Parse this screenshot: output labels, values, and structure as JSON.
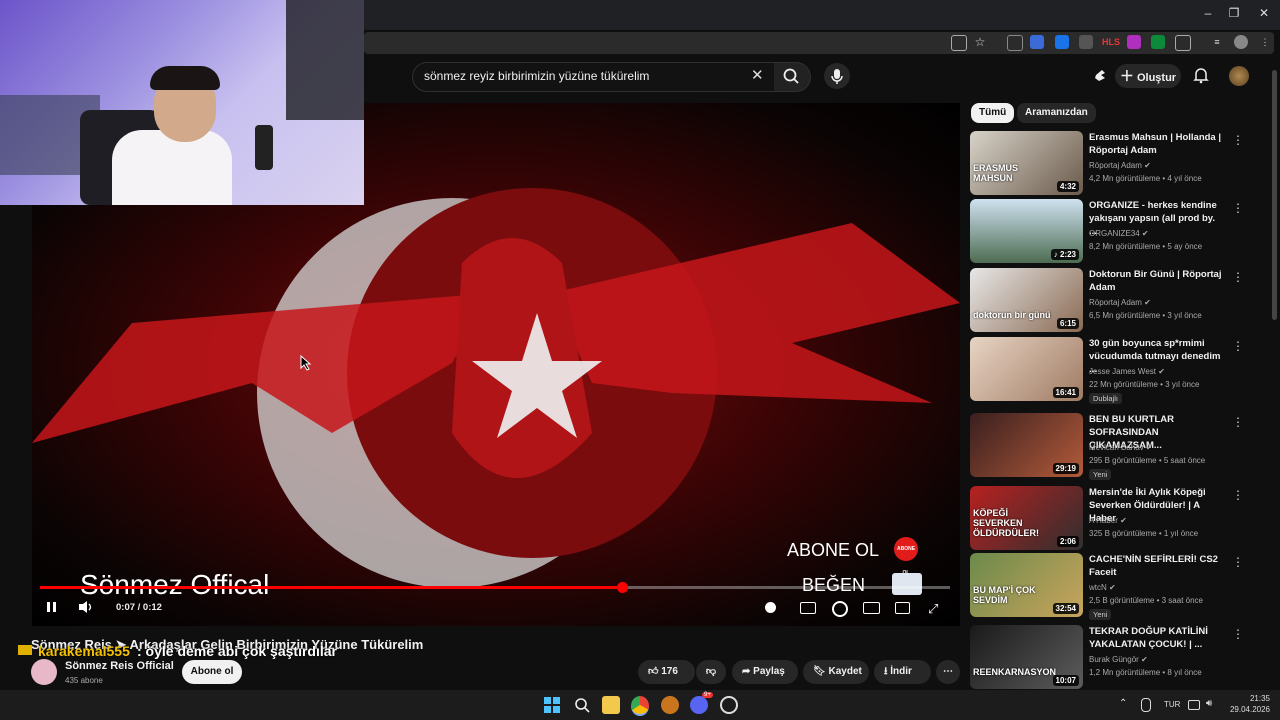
{
  "browser": {
    "window_controls": [
      "–",
      "❐",
      "✕"
    ]
  },
  "header": {
    "search_query": "sönmez reyiz birbirimizin yüzüne tükürelim",
    "create_label": "Oluştur"
  },
  "chips": [
    "Tümü",
    "Aramanızdan"
  ],
  "player": {
    "overlay_subscribe": "ABONE OL",
    "overlay_subscribe_icon": "ABONE OL",
    "overlay_like": "BEĞEN",
    "watermark": "Sönmez Offical",
    "time": "0:07 / 0:12",
    "progress": 0.64
  },
  "video": {
    "title": "Sönmez Reis ➤ Arkadaşlar Gelin Birbirimizin Yüzüne Tükürelim",
    "chat_user": "karakemal555",
    "chat_message": ": öyle deme abi çok şaştırdılar",
    "channel": "Sönmez Reis  Official",
    "subscribers": "435 abone",
    "subscribe_label": "Abone ol",
    "likes": "176",
    "share_label": "Paylaş",
    "save_label": "Kaydet",
    "download_label": "İndir"
  },
  "recommendations": [
    {
      "title": "Erasmus Mahsun | Hollanda | Röportaj Adam",
      "channel": "Röportaj Adam",
      "meta": "4,2 Mn görüntüleme • 4 yıl önce",
      "duration": "4:32",
      "thumb_text": "ERASMUS MAHSUN",
      "badge": ""
    },
    {
      "title": "ORGANIZE - herkes kendine yakışanı yapsın (all prod by. ...",
      "channel": "ORGANIZE34",
      "meta": "8,2 Mn görüntüleme • 5 ay önce",
      "duration": "♪ 2:23",
      "thumb_text": "",
      "badge": ""
    },
    {
      "title": "Doktorun Bir Günü | Röportaj Adam",
      "channel": "Röportaj Adam",
      "meta": "6,5 Mn görüntüleme • 3 yıl önce",
      "duration": "6:15",
      "thumb_text": "doktorun bir günü",
      "badge": ""
    },
    {
      "title": "30 gün boyunca sp*rmimi vücudumda tutmayı denedim ...",
      "channel": "Jesse James West",
      "meta": "22 Mn görüntüleme • 3 yıl önce",
      "duration": "16:41",
      "thumb_text": "",
      "badge": "Dublajlı"
    },
    {
      "title": "BEN BU KURTLAR SOFRASINDAN ÇIKAMAZSAM...",
      "channel": "Mevlcan Bahav",
      "meta": "295 B görüntüleme • 5 saat önce",
      "duration": "29:19",
      "thumb_text": "",
      "badge": "Yeni"
    },
    {
      "title": "Mersin'de İki Aylık Köpeği Severken Öldürdüler! | A Haber",
      "channel": "A Haber",
      "meta": "325 B görüntüleme • 1 yıl önce",
      "duration": "2:06",
      "thumb_text": "KÖPEĞİ SEVERKEN ÖLDÜRDÜLER!",
      "badge": ""
    },
    {
      "title": "CACHE'NİN SEFİRLERİ! CS2 Faceit",
      "channel": "wtcN",
      "meta": "2,5 B görüntüleme • 3 saat önce",
      "duration": "32:54",
      "thumb_text": "BU MAP'İ ÇOK SEVDİM",
      "badge": "Yeni"
    },
    {
      "title": "TEKRAR DOĞUP KATİLİNİ YAKALATAN ÇOCUK! | ...",
      "channel": "Burak Güngör",
      "meta": "1,2 Mn görüntüleme • 8 yıl önce",
      "duration": "10:07",
      "thumb_text": "REENKARNASYON",
      "badge": ""
    }
  ],
  "taskbar": {
    "lang": "TUR",
    "time": "21:35",
    "date": "29.04.2026",
    "discord_badge": "9+"
  },
  "colors": {
    "youtube_red": "#ff0000",
    "bg": "#0f0f0f",
    "chip_active": "#f1f1f1"
  }
}
